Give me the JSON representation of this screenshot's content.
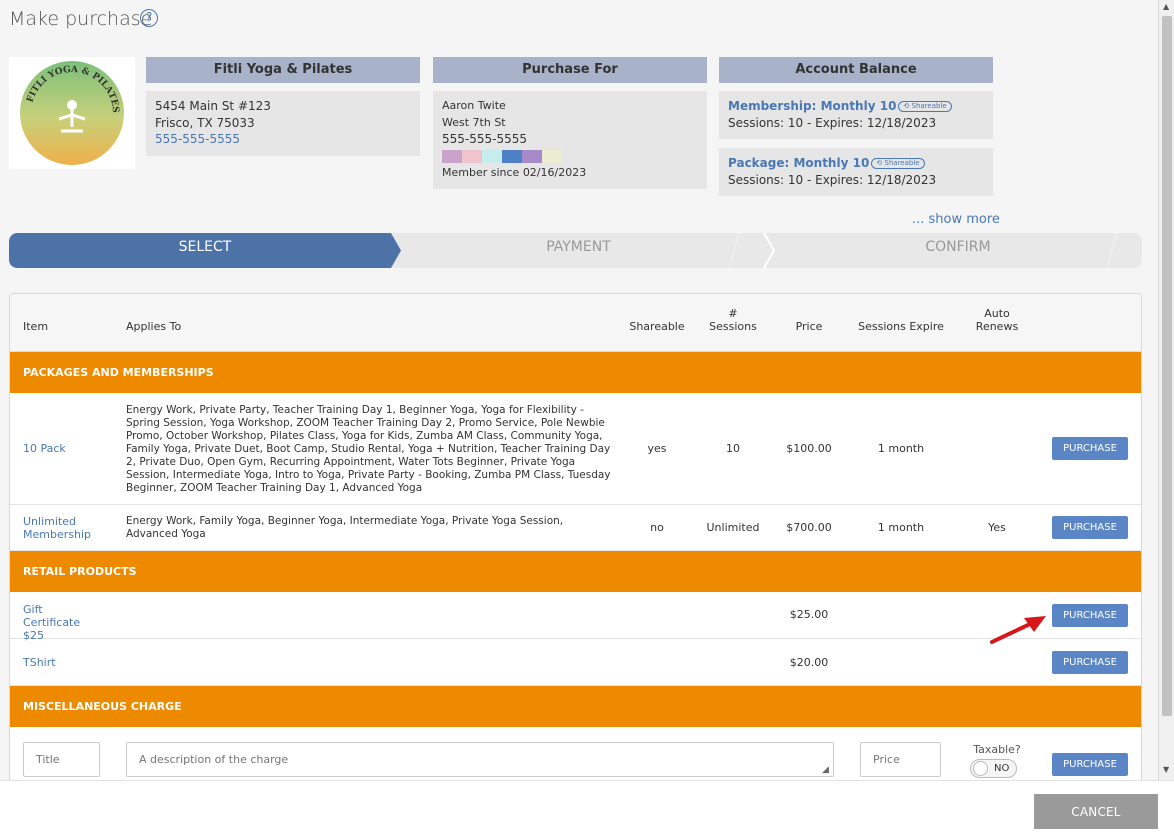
{
  "title": "Make purchase",
  "studio": {
    "name": "Fitli Yoga & Pilates",
    "address1": "5454 Main St #123",
    "address2": "Frisco, TX 75033",
    "phone": "555-555-5555",
    "logo_text": "FITLI YOGA & PILATES"
  },
  "purchase_for": {
    "heading": "Purchase For",
    "name": "Aaron Twite",
    "street": "West 7th St",
    "phone": "555-555-5555",
    "member_since": "Member since 02/16/2023",
    "swatch_colors": [
      "#c9a3c9",
      "#f0c4cc",
      "#c6ecec",
      "#4d80c4",
      "#a68ac9",
      "#ececd0"
    ]
  },
  "balance": {
    "heading": "Account Balance",
    "items": [
      {
        "title": "Membership: Monthly 10",
        "tag": "Shareable",
        "detail": "Sessions: 10 -  Expires: 12/18/2023"
      },
      {
        "title": "Package: Monthly 10",
        "tag": "Shareable",
        "detail": "Sessions: 10 -  Expires: 12/18/2023"
      }
    ],
    "show_more": "... show more"
  },
  "steps": [
    "SELECT",
    "PAYMENT",
    "CONFIRM"
  ],
  "table": {
    "headers": {
      "item": "Item",
      "applies": "Applies To",
      "shareable": "Shareable",
      "sessions1": "#",
      "sessions2": "Sessions",
      "price": "Price",
      "expire": "Sessions Expire",
      "auto1": "Auto",
      "auto2": "Renews"
    },
    "section_packages": "PACKAGES AND MEMBERSHIPS",
    "section_retail": "RETAIL PRODUCTS",
    "section_misc": "MISCELLANEOUS CHARGE",
    "rows": [
      {
        "item": "10 Pack",
        "applies": "Energy Work, Private Party, Teacher Training Day 1, Beginner Yoga, Yoga for Flexibility - Spring Session, Yoga Workshop, ZOOM Teacher Training Day 2, Promo Service, Pole Newbie Promo, October Workshop, Pilates Class, Yoga for Kids, Zumba AM Class, Community Yoga, Family Yoga, Private Duet, Boot Camp, Studio Rental, Yoga + Nutrition, Teacher Training Day 2, Private Duo, Open Gym, Recurring Appointment, Water Tots Beginner, Private Yoga Session, Intermediate Yoga, Intro to Yoga, Private Party - Booking, Zumba PM Class, Tuesday Beginner, ZOOM Teacher Training Day 1, Advanced Yoga",
        "shareable": "yes",
        "sessions": "10",
        "price": "$100.00",
        "expire": "1 month",
        "auto": ""
      },
      {
        "item": "Unlimited Membership",
        "applies": "Energy Work, Family Yoga, Beginner Yoga, Intermediate Yoga, Private Yoga Session, Advanced Yoga",
        "shareable": "no",
        "sessions": "Unlimited",
        "price": "$700.00",
        "expire": "1 month",
        "auto": "Yes"
      },
      {
        "item": "Gift Certificate $25",
        "price": "$25.00"
      },
      {
        "item": "TShirt",
        "price": "$20.00"
      }
    ],
    "purchase_label": "PURCHASE",
    "misc": {
      "title_placeholder": "Title",
      "desc_placeholder": "A description of the charge",
      "price_placeholder": "Price",
      "taxable_label": "Taxable?",
      "toggle_label": "NO"
    }
  },
  "cancel_label": "CANCEL"
}
